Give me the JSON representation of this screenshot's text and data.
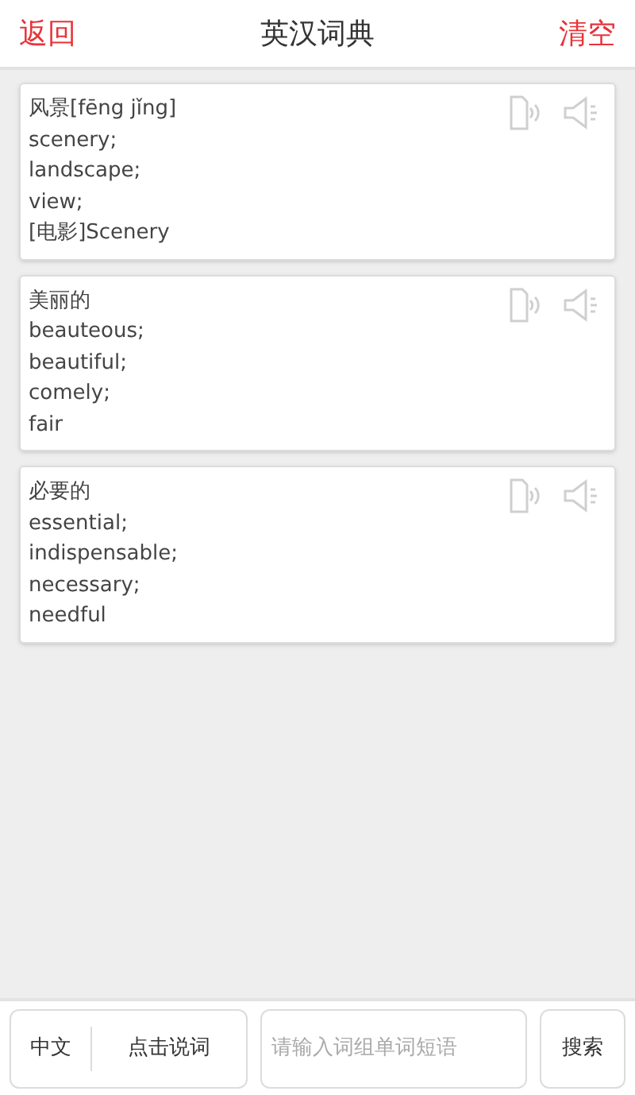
{
  "header": {
    "back": "返回",
    "title": "英汉词典",
    "clear": "清空"
  },
  "entries": [
    {
      "headword": "风景[fēng jǐng]",
      "definitions": [
        "scenery;",
        "landscape;",
        "view;",
        "[电影]Scenery"
      ]
    },
    {
      "headword": "美丽的",
      "definitions": [
        "beauteous;",
        "beautiful;",
        "comely;",
        "fair"
      ]
    },
    {
      "headword": "必要的",
      "definitions": [
        "essential;",
        "indispensable;",
        "necessary;",
        "needful"
      ]
    }
  ],
  "bottom_bar": {
    "language": "中文",
    "voice": "点击说词",
    "search_field": {
      "placeholder": "请输入词组单词短语"
    },
    "search": "搜索"
  }
}
